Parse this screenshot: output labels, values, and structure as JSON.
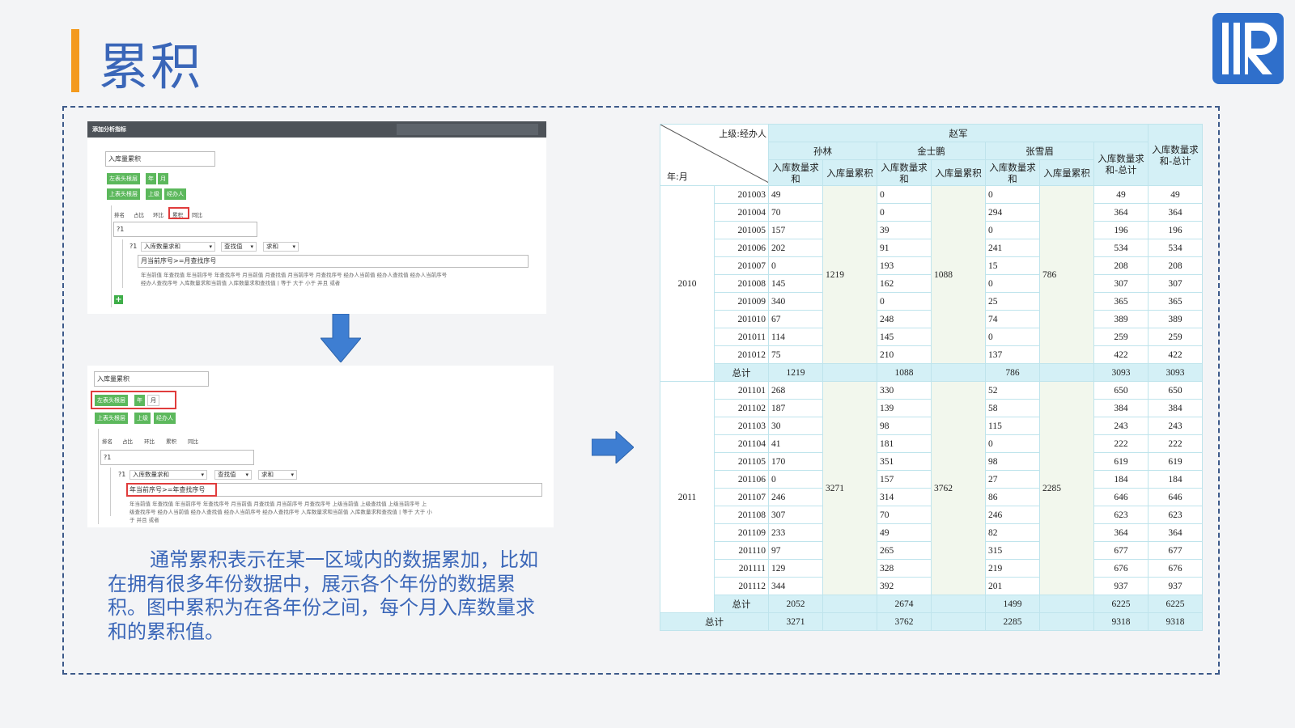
{
  "slide": {
    "title": "累积",
    "description": "通常累积表示在某一区域内的数据累加，比如在拥有很多年份数据中，展示各个年份的数据累积。图中累积为在各年份之间，每个月入库数量求和的累积值。"
  },
  "logo": {
    "letter": "R",
    "color": "#2f6fcb"
  },
  "colors": {
    "accent": "#f39a1e",
    "title": "#3a66b8",
    "chip": "#5cb85c",
    "highlight": "#e03c3c",
    "table_header": "#d4f0f6"
  },
  "dialog1": {
    "title": "添加分析指标",
    "name_value": "入库量累积",
    "row1_label": "左表头根层",
    "row1_chips": [
      "年",
      "月"
    ],
    "row2_label": "上表头根层",
    "row2_chips": [
      "上级",
      "经办人"
    ],
    "tabs": [
      "排名",
      "占比",
      "环比",
      "累积",
      "同比"
    ],
    "expr_value": "?1",
    "param_label": "?1",
    "dd_measure": "入库数量求和",
    "dd_lookup": "查找值",
    "dd_agg": "求和",
    "cond_value": "月当前序号>=月查找序号",
    "hint_line1": "年当前值  年查找值  年当前序号  年查找序号  月当前值  月查找值  月当前序号  月查找序号  经办人当前值  经办人查找值  经办人当前序号",
    "hint_line2": "经办人查找序号  入库数量求和当前值  入库数量求和查找值  |  等于  大于  小于  并且  或者",
    "plus": "+"
  },
  "dialog2": {
    "name_value": "入库量累积",
    "row1_label": "左表头根层",
    "row1_chips": [
      "年",
      "月"
    ],
    "row2_label": "上表头根层",
    "row2_chips": [
      "上级",
      "经办人"
    ],
    "tabs": [
      "排名",
      "占比",
      "环比",
      "累积",
      "同比"
    ],
    "expr_value": "?1",
    "param_label": "?1",
    "dd_measure": "入库数量求和",
    "dd_lookup": "查找值",
    "dd_agg": "求和",
    "cond_value": "年当前序号>=年查找序号",
    "hint_line1": "年当前值  年查找值  年当前序号  年查找序号  月当前值  月查找值  月当前序号  月查找序号  上级当前值  上级查找值  上级当前序号  上",
    "hint_line2": "级查找序号  经办人当前值  经办人查找值  经办人当前序号  经办人查找序号  入库数量求和当前值  入库数量求和查找值  |  等于  大于  小",
    "hint_line3": "于  并且  或者"
  },
  "report": {
    "corner_top": "上级:经办人",
    "corner_bottom": "年:月",
    "group": "赵军",
    "persons": [
      "孙林",
      "金士鹏",
      "张雪眉"
    ],
    "col_sum": "入库数量求和",
    "col_cum": "入库量累积",
    "col_total_inner": "入库数量求和-总计",
    "col_total_outer": "入库数量求和-总计",
    "total_label": "总计",
    "years": [
      {
        "year": "2010",
        "cum": [
          "1219",
          "1088",
          "786"
        ],
        "rows": [
          {
            "m": "201003",
            "v": [
              "49",
              "0",
              "0"
            ],
            "t1": "49",
            "t2": "49"
          },
          {
            "m": "201004",
            "v": [
              "70",
              "0",
              "294"
            ],
            "t1": "364",
            "t2": "364"
          },
          {
            "m": "201005",
            "v": [
              "157",
              "39",
              "0"
            ],
            "t1": "196",
            "t2": "196"
          },
          {
            "m": "201006",
            "v": [
              "202",
              "91",
              "241"
            ],
            "t1": "534",
            "t2": "534"
          },
          {
            "m": "201007",
            "v": [
              "0",
              "193",
              "15"
            ],
            "t1": "208",
            "t2": "208"
          },
          {
            "m": "201008",
            "v": [
              "145",
              "162",
              "0"
            ],
            "t1": "307",
            "t2": "307"
          },
          {
            "m": "201009",
            "v": [
              "340",
              "0",
              "25"
            ],
            "t1": "365",
            "t2": "365"
          },
          {
            "m": "201010",
            "v": [
              "67",
              "248",
              "74"
            ],
            "t1": "389",
            "t2": "389"
          },
          {
            "m": "201011",
            "v": [
              "114",
              "145",
              "0"
            ],
            "t1": "259",
            "t2": "259"
          },
          {
            "m": "201012",
            "v": [
              "75",
              "210",
              "137"
            ],
            "t1": "422",
            "t2": "422"
          }
        ],
        "subtotal": {
          "v": [
            "1219",
            "1088",
            "786"
          ],
          "t1": "3093",
          "t2": "3093"
        }
      },
      {
        "year": "2011",
        "cum": [
          "3271",
          "3762",
          "2285"
        ],
        "rows": [
          {
            "m": "201101",
            "v": [
              "268",
              "330",
              "52"
            ],
            "t1": "650",
            "t2": "650"
          },
          {
            "m": "201102",
            "v": [
              "187",
              "139",
              "58"
            ],
            "t1": "384",
            "t2": "384"
          },
          {
            "m": "201103",
            "v": [
              "30",
              "98",
              "115"
            ],
            "t1": "243",
            "t2": "243"
          },
          {
            "m": "201104",
            "v": [
              "41",
              "181",
              "0"
            ],
            "t1": "222",
            "t2": "222"
          },
          {
            "m": "201105",
            "v": [
              "170",
              "351",
              "98"
            ],
            "t1": "619",
            "t2": "619"
          },
          {
            "m": "201106",
            "v": [
              "0",
              "157",
              "27"
            ],
            "t1": "184",
            "t2": "184"
          },
          {
            "m": "201107",
            "v": [
              "246",
              "314",
              "86"
            ],
            "t1": "646",
            "t2": "646"
          },
          {
            "m": "201108",
            "v": [
              "307",
              "70",
              "246"
            ],
            "t1": "623",
            "t2": "623"
          },
          {
            "m": "201109",
            "v": [
              "233",
              "49",
              "82"
            ],
            "t1": "364",
            "t2": "364"
          },
          {
            "m": "201110",
            "v": [
              "97",
              "265",
              "315"
            ],
            "t1": "677",
            "t2": "677"
          },
          {
            "m": "201111",
            "v": [
              "129",
              "328",
              "219"
            ],
            "t1": "676",
            "t2": "676"
          },
          {
            "m": "201112",
            "v": [
              "344",
              "392",
              "201"
            ],
            "t1": "937",
            "t2": "937"
          }
        ],
        "subtotal": {
          "v": [
            "2052",
            "2674",
            "1499"
          ],
          "t1": "6225",
          "t2": "6225"
        }
      }
    ],
    "grand_total": {
      "v": [
        "3271",
        "3762",
        "2285"
      ],
      "t1": "9318",
      "t2": "9318"
    }
  }
}
